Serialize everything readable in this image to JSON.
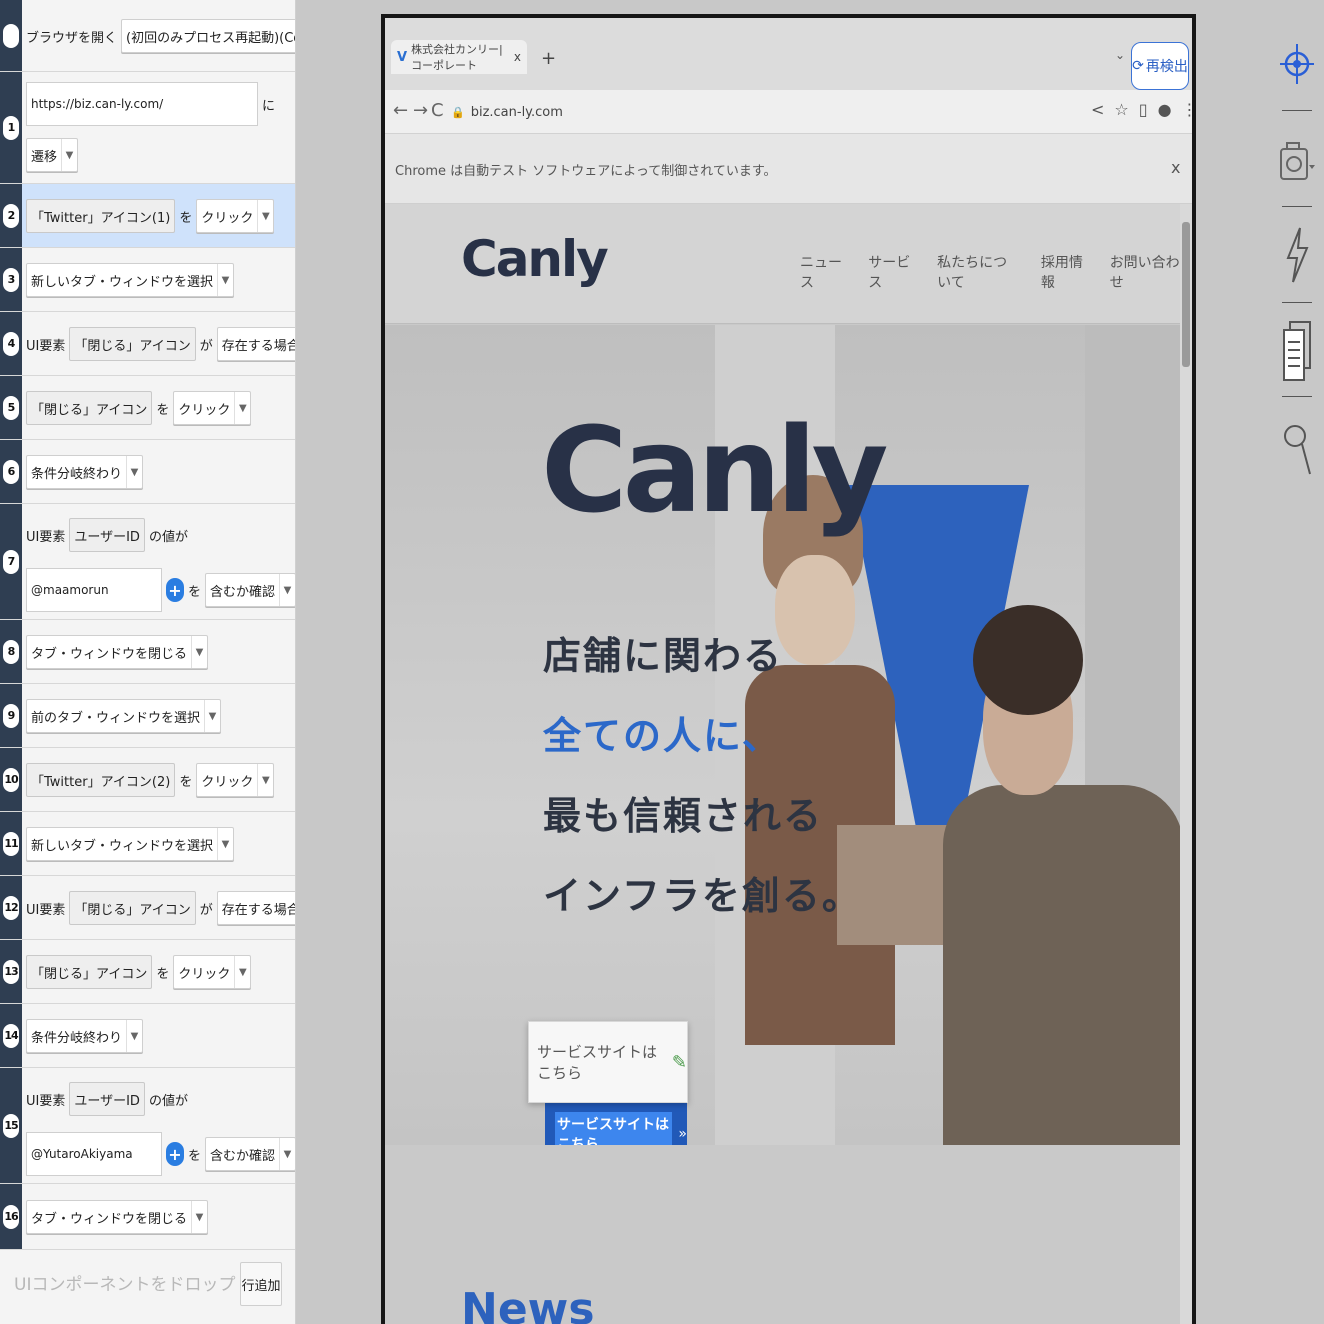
{
  "steps": [
    {
      "num": "",
      "parts": [
        {
          "k": "txt",
          "v": "ブラウザを開く"
        },
        {
          "k": "dd",
          "v": "(初回のみプロセス再起動)(Cookieをクリア)"
        }
      ]
    },
    {
      "num": "1",
      "url": "https://biz.can-ly.com/",
      "suffix": "に",
      "action": "遷移"
    },
    {
      "num": "2",
      "selected": true,
      "parts": [
        {
          "k": "chip",
          "v": "「Twitter」アイコン(1)"
        },
        {
          "k": "txt",
          "v": "を"
        },
        {
          "k": "dd",
          "v": "クリック"
        }
      ]
    },
    {
      "num": "3",
      "parts": [
        {
          "k": "dd",
          "v": "新しいタブ・ウィンドウを選択"
        }
      ]
    },
    {
      "num": "4",
      "parts": [
        {
          "k": "txt",
          "v": "UI要素"
        },
        {
          "k": "chip",
          "v": "「閉じる」アイコン"
        },
        {
          "k": "txt",
          "v": "が"
        },
        {
          "k": "dd",
          "v": "存在する場合"
        }
      ]
    },
    {
      "num": "5",
      "parts": [
        {
          "k": "chip",
          "v": "「閉じる」アイコン"
        },
        {
          "k": "txt",
          "v": "を"
        },
        {
          "k": "dd",
          "v": "クリック"
        }
      ]
    },
    {
      "num": "6",
      "parts": [
        {
          "k": "dd",
          "v": "条件分岐終わり"
        }
      ]
    },
    {
      "num": "7",
      "prefix": "UI要素",
      "element": "ユーザーID",
      "mid": "の値が",
      "value": "@maamorun",
      "wo": "を",
      "op": "含むか確認"
    },
    {
      "num": "8",
      "parts": [
        {
          "k": "dd",
          "v": "タブ・ウィンドウを閉じる"
        }
      ]
    },
    {
      "num": "9",
      "parts": [
        {
          "k": "dd",
          "v": "前のタブ・ウィンドウを選択"
        }
      ]
    },
    {
      "num": "10",
      "parts": [
        {
          "k": "chip",
          "v": "「Twitter」アイコン(2)"
        },
        {
          "k": "txt",
          "v": "を"
        },
        {
          "k": "dd",
          "v": "クリック"
        }
      ]
    },
    {
      "num": "11",
      "parts": [
        {
          "k": "dd",
          "v": "新しいタブ・ウィンドウを選択"
        }
      ]
    },
    {
      "num": "12",
      "parts": [
        {
          "k": "txt",
          "v": "UI要素"
        },
        {
          "k": "chip",
          "v": "「閉じる」アイコン"
        },
        {
          "k": "txt",
          "v": "が"
        },
        {
          "k": "dd",
          "v": "存在する場合"
        }
      ]
    },
    {
      "num": "13",
      "parts": [
        {
          "k": "chip",
          "v": "「閉じる」アイコン"
        },
        {
          "k": "txt",
          "v": "を"
        },
        {
          "k": "dd",
          "v": "クリック"
        }
      ]
    },
    {
      "num": "14",
      "parts": [
        {
          "k": "dd",
          "v": "条件分岐終わり"
        }
      ]
    },
    {
      "num": "15",
      "prefix": "UI要素",
      "element": "ユーザーID",
      "mid": "の値が",
      "value": "@YutaroAkiyama",
      "wo": "を",
      "op": "含むか確認"
    },
    {
      "num": "16",
      "parts": [
        {
          "k": "dd",
          "v": "タブ・ウィンドウを閉じる"
        }
      ]
    }
  ],
  "panel_footer": {
    "drop_label": "UIコンポーネントをドロップ",
    "add_row": "行追加"
  },
  "browser": {
    "tab_title": "株式会社カンリー|コーポレート",
    "tab_close": "x",
    "new_tab": "+",
    "tab_menu": "⌄",
    "redetect": "再検出",
    "url": "biz.can-ly.com",
    "infobar": "Chrome は自動テスト ソフトウェアによって制御されています。",
    "infobar_close": "x"
  },
  "site": {
    "logo": "Canly",
    "nav": [
      "ニュース",
      "サービス",
      "私たちについて",
      "採用情報",
      "お問い合わせ"
    ],
    "hero_logo": "Canly",
    "copy": [
      "店舗に関わる",
      "全ての人に、",
      "最も信頼される",
      "インフラを創る。"
    ],
    "tooltip": "サービスサイトはこちら",
    "service_button": "サービスサイトはこちら",
    "service_arrow": "»",
    "news_title": "News"
  },
  "icons": {
    "target": "crosshair-target-icon",
    "camera": "camera-icon",
    "flash": "lightning-icon",
    "copy": "document-copy-icon",
    "search": "magnifier-icon"
  },
  "colors": {
    "gutter": "#2f3e52",
    "selected_row": "#cfe2fb",
    "brand_blue": "#2b68c9"
  }
}
